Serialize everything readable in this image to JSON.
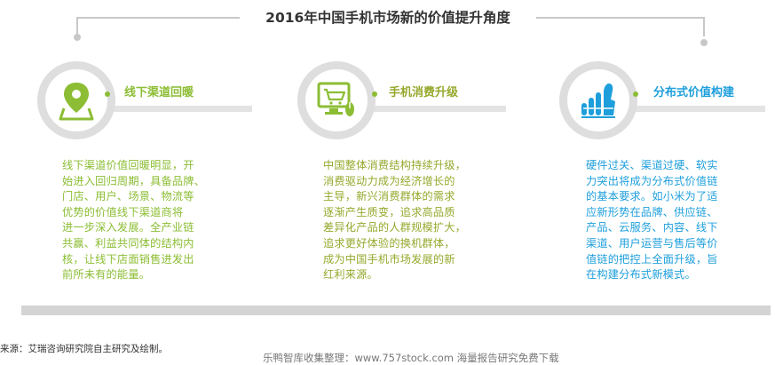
{
  "title": "2016年中国手机市场新的价值提升角度",
  "colors": {
    "green": "#8cbd34",
    "text_green": "#8cbd34",
    "text_olive": "#96a82c",
    "blue": "#1e9fdc",
    "text_blue": "#1e9fdc",
    "ring": "#dedede"
  },
  "columns": [
    {
      "label": "线下渠道回暖",
      "icon": "location-pin-icon",
      "lines": [
        "线下渠道价值回暖明显，开",
        "始进入回归周期，具备品牌、",
        "门店、用户、场景、物流等",
        "优势的价值线下渠道商将",
        "进一步深入发展。全产业链",
        "共赢、利益共同体的结构内",
        "核，让线下店面销售进发出",
        "前所未有的能量。"
      ]
    },
    {
      "label": "手机消费升级",
      "icon": "shopping-cart-monitor-icon",
      "lines": [
        "中国整体消费结构持续升级，",
        "消费驱动力成为经济增长的",
        "主导，新兴消费群体的需求",
        "逐渐产生质变，追求高品质",
        "差异化产品的人群规模扩大，",
        "追求更好体验的换机群体，",
        "成为中国手机市场发展的新",
        "红利来源。"
      ]
    },
    {
      "label": "分布式价值构建",
      "icon": "bar-hand-icon",
      "lines": [
        "硬件过关、渠道过硬、软实",
        "力突出将成为分布式价值链",
        "的基本要求。如小米为了适",
        "应新形势在品牌、供应链、",
        "产品、云服务、内容、线下",
        "渠道、用户运营与售后等价",
        "值链的把控上全面升级，旨",
        "在构建分布式新模式。"
      ]
    }
  ],
  "source": "来源：艾瑞咨询研究院自主研究及绘制。",
  "watermark": "乐鸭智库收集整理：www.757stock.com 海量报告研究免费下载"
}
